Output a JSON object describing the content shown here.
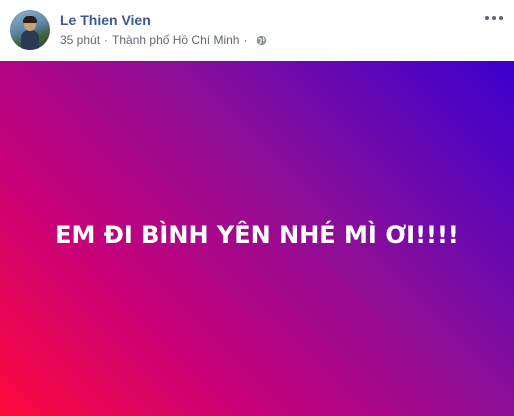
{
  "post": {
    "author_name": "Le Thien Vien",
    "time": "35 phút",
    "separator": "·",
    "location": "Thành phố Hồ Chí Minh",
    "privacy_icon": "globe-icon",
    "options_icon": "more-horizontal-icon",
    "status_text": "EM ĐI BÌNH YÊN NHÉ MÌ ƠI!!!!",
    "background_colors": [
      "#ff0a3c",
      "#c6007a",
      "#8b0e98",
      "#3a00d0"
    ],
    "author_color": "#385898"
  }
}
